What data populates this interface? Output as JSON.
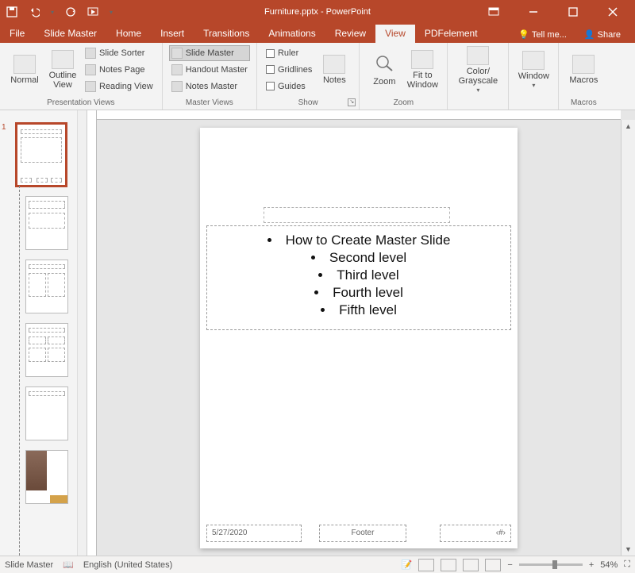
{
  "app": {
    "title": "Furniture.pptx - PowerPoint"
  },
  "qat": {
    "save": "save-icon",
    "undo": "undo-icon",
    "redo": "redo-icon",
    "start": "start-from-beginning-icon",
    "customize": "customize-qat-icon"
  },
  "tabs": {
    "file": "File",
    "items": [
      "Slide Master",
      "Home",
      "Insert",
      "Transitions",
      "Animations",
      "Review",
      "View",
      "PDFelement"
    ],
    "active_index": 6,
    "tellme": "Tell me...",
    "share": "Share"
  },
  "ribbon": {
    "presentation_views": {
      "label": "Presentation Views",
      "normal": "Normal",
      "outline": "Outline View",
      "slide_sorter": "Slide Sorter",
      "notes_page": "Notes Page",
      "reading_view": "Reading View"
    },
    "master_views": {
      "label": "Master Views",
      "slide_master": "Slide Master",
      "handout_master": "Handout Master",
      "notes_master": "Notes Master"
    },
    "show": {
      "label": "Show",
      "ruler": "Ruler",
      "gridlines": "Gridlines",
      "guides": "Guides",
      "notes": "Notes"
    },
    "zoom": {
      "label": "Zoom",
      "zoom": "Zoom",
      "fit": "Fit to Window"
    },
    "color": {
      "label": "Color/ Grayscale",
      "btn": "Color/ Grayscale"
    },
    "window": {
      "label": "",
      "btn": "Window"
    },
    "macros": {
      "label": "Macros",
      "btn": "Macros"
    }
  },
  "thumbs": {
    "master_number": "1"
  },
  "slide": {
    "body": {
      "l1": "How to Create Master Slide",
      "l2": "Second level",
      "l3": "Third level",
      "l4": "Fourth level",
      "l5": "Fifth level"
    },
    "date": "5/27/2020",
    "footer": "Footer",
    "num": "‹#›"
  },
  "status": {
    "mode": "Slide Master",
    "lang": "English (United States)",
    "zoom": "54%"
  }
}
